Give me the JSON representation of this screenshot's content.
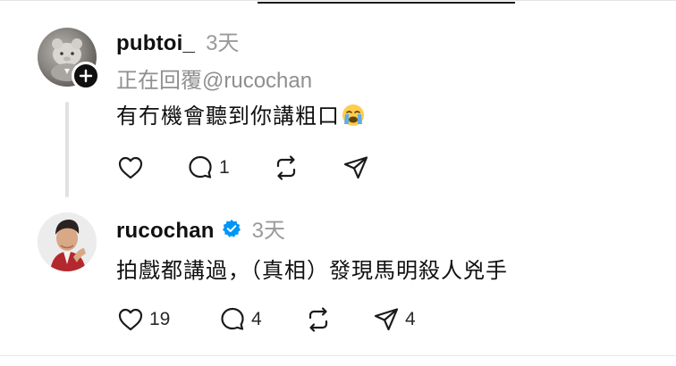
{
  "posts": [
    {
      "username": "pubtoi_",
      "time": "3天",
      "replying_to": "正在回覆@rucochan",
      "text": "有冇機會聽到你講粗口",
      "emoji": "loudly-crying-face",
      "actions": {
        "like_count": "",
        "reply_count": "1",
        "repost_count": "",
        "share_count": ""
      }
    },
    {
      "username": "rucochan",
      "verified": true,
      "time": "3天",
      "text": "拍戲都講過，（真相）發現馬明殺人兇手",
      "actions": {
        "like_count": "19",
        "reply_count": "4",
        "repost_count": "",
        "share_count": "4"
      }
    }
  ],
  "icons": [
    "heart-icon",
    "comment-icon",
    "repost-icon",
    "share-icon",
    "plus-icon",
    "verified-icon"
  ],
  "colors": {
    "text": "#101010",
    "muted": "#9a9a9a",
    "verified": "#0095f6",
    "thread_line": "#e1e1e1"
  }
}
